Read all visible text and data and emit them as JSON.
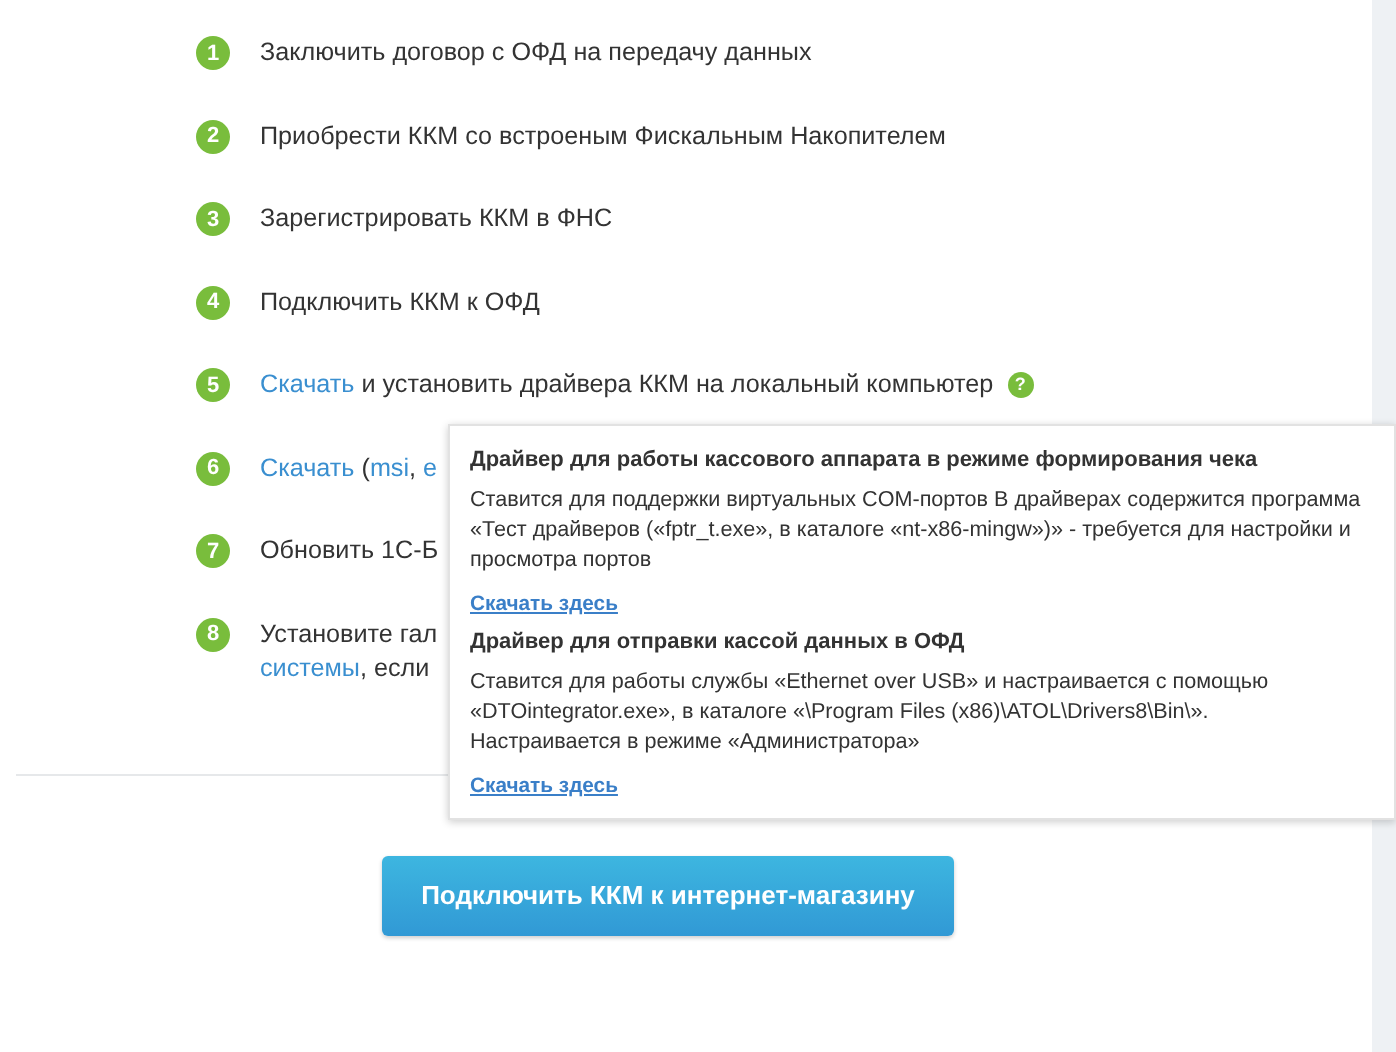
{
  "steps": [
    {
      "number": "1",
      "lines": [
        [
          {
            "text": "Заключить договор с ОФД на передачу данных",
            "link": false
          }
        ]
      ]
    },
    {
      "number": "2",
      "lines": [
        [
          {
            "text": "Приобрести ККМ со встроеным Фискальным Накопителем",
            "link": false
          }
        ]
      ]
    },
    {
      "number": "3",
      "lines": [
        [
          {
            "text": "Зарегистрировать ККМ в ФНС",
            "link": false
          }
        ]
      ]
    },
    {
      "number": "4",
      "lines": [
        [
          {
            "text": "Подключить ККМ к ОФД",
            "link": false
          }
        ]
      ]
    },
    {
      "number": "5",
      "lines": [
        [
          {
            "text": "Скачать",
            "link": true
          },
          {
            "text": " и установить драйвера ККМ на локальный компьютер",
            "link": false
          }
        ]
      ],
      "help": "?"
    },
    {
      "number": "6",
      "lines": [
        [
          {
            "text": "Скачать",
            "link": true
          },
          {
            "text": " (",
            "link": false
          },
          {
            "text": "msi",
            "link": true
          },
          {
            "text": ", ",
            "link": false
          },
          {
            "text": "e",
            "link": true
          }
        ]
      ]
    },
    {
      "number": "7",
      "lines": [
        [
          {
            "text": "Обновить 1С-Б",
            "link": false
          }
        ]
      ]
    },
    {
      "number": "8",
      "lines": [
        [
          {
            "text": "Установите гал",
            "link": false
          }
        ],
        [
          {
            "text": "системы",
            "link": true
          },
          {
            "text": ", если",
            "link": false
          }
        ]
      ]
    }
  ],
  "tooltip": {
    "sections": [
      {
        "title": "Драйвер для работы кассового аппарата в режиме формирования чека",
        "text": "Ставится для поддержки виртуальных COM-портов В драйверах содержится программа «Тест драйверов («fptr_t.exe», в каталоге «nt-x86-mingw»)» - требуется для настройки и просмотра портов",
        "link": "Скачать здесь"
      },
      {
        "title": "Драйвер для отправки кассой данных в ОФД",
        "text": "Ставится для работы службы «Ethernet over USB» и настраивается с помощью «DTOintegrator.exe», в каталоге «\\Program Files (x86)\\ATOL\\Drivers8\\Bin\\». Настраивается в режиме «Администратора»",
        "link": "Скачать здесь"
      }
    ]
  },
  "button": "Подключить ККМ к интернет-магазину"
}
